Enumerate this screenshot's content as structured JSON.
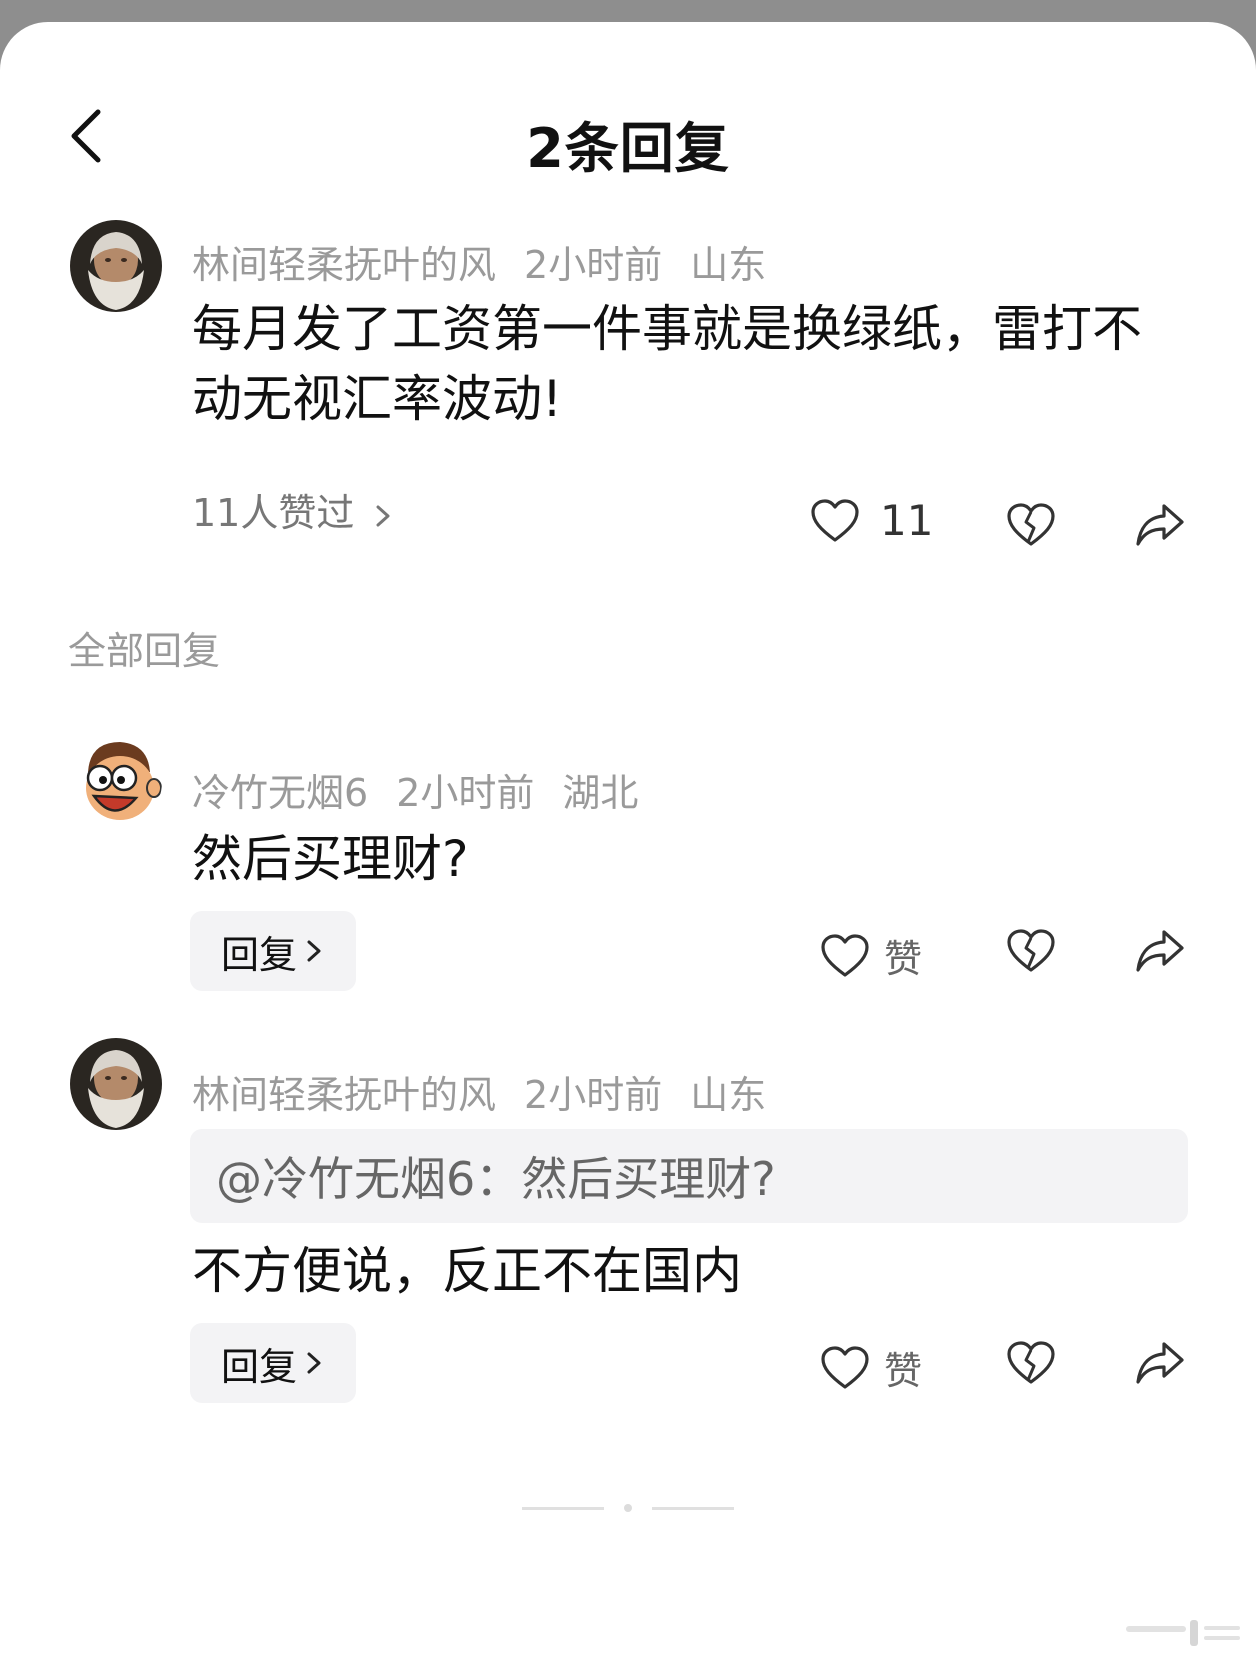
{
  "header": {
    "title": "2条回复"
  },
  "main_comment": {
    "username": "林间轻柔抚叶的风",
    "time": "2小时前",
    "location": "山东",
    "text": "每月发了工资第一件事就是换绿纸，雷打不动无视汇率波动!",
    "likes_link": "11人赞过",
    "like_count": "11",
    "avatar_icon": "bearded-man-avatar"
  },
  "section": {
    "label": "全部回复"
  },
  "replies": [
    {
      "username": "冷竹无烟6",
      "time": "2小时前",
      "location": "湖北",
      "text": "然后买理财?",
      "reply_button": "回复",
      "like_label": "赞",
      "avatar_icon": "cartoon-face-avatar"
    },
    {
      "username": "林间轻柔抚叶的风",
      "time": "2小时前",
      "location": "山东",
      "quote": "@冷竹无烟6：然后买理财?",
      "text": "不方便说，反正不在国内",
      "reply_button": "回复",
      "like_label": "赞",
      "avatar_icon": "bearded-man-avatar"
    }
  ],
  "colors": {
    "background": "#ffffff",
    "frame": "#8e8e8e",
    "meta_text": "#9a9a9a",
    "button_bg": "#f3f3f5"
  }
}
